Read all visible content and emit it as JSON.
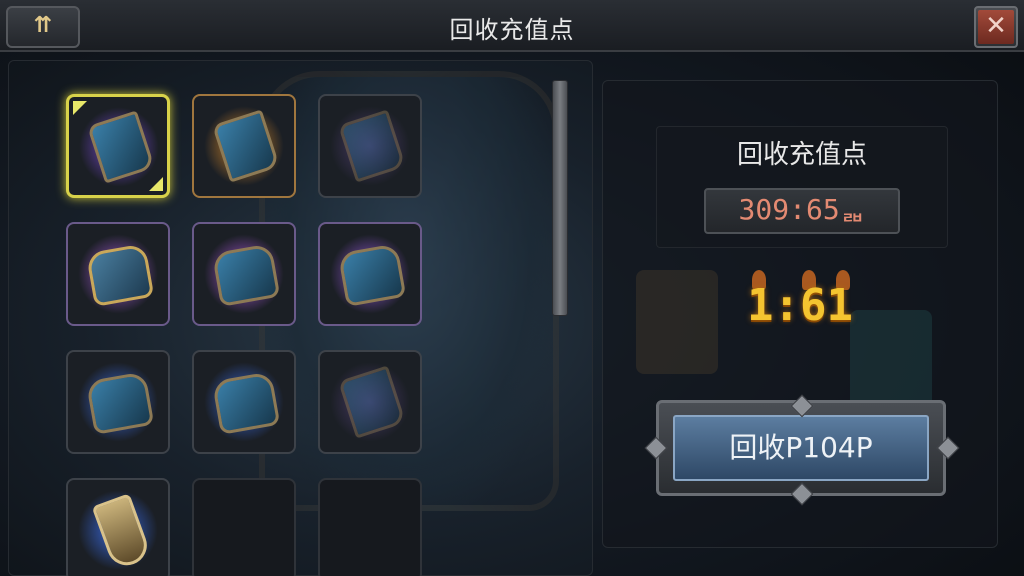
{
  "window": {
    "title": "回收充值点",
    "up_icon_label": "⇈",
    "close_icon_label": "✕"
  },
  "inventory": {
    "slots": [
      {
        "row": 1,
        "col": 1,
        "item": "blue-armor-piece",
        "state": "selected",
        "glow": "#7a4ad8"
      },
      {
        "row": 1,
        "col": 2,
        "item": "blue-armor-piece",
        "state": "normal",
        "glow": "#d98a2a"
      },
      {
        "row": 1,
        "col": 3,
        "item": "blue-armor-piece",
        "state": "dim",
        "glow": "#4a3a6a"
      },
      {
        "row": 2,
        "col": 1,
        "item": "gold-chest-armor",
        "state": "normal",
        "glow": "#a65ad8"
      },
      {
        "row": 2,
        "col": 2,
        "item": "blue-chest-armor",
        "state": "normal",
        "glow": "#b05ae0"
      },
      {
        "row": 2,
        "col": 3,
        "item": "blue-chest-armor",
        "state": "normal",
        "glow": "#9a5ae0"
      },
      {
        "row": 3,
        "col": 1,
        "item": "blue-chest-armor",
        "state": "normal",
        "glow": "#3a6ae0"
      },
      {
        "row": 3,
        "col": 2,
        "item": "blue-chest-armor",
        "state": "normal",
        "glow": "#3a6ae0"
      },
      {
        "row": 3,
        "col": 3,
        "item": "blue-armor-piece",
        "state": "dim",
        "glow": "#4a3a6a"
      },
      {
        "row": 4,
        "col": 1,
        "item": "gold-bell-weapon",
        "state": "normal",
        "glow": "#3a6ae0"
      },
      {
        "row": 4,
        "col": 2,
        "item": "",
        "state": "empty",
        "glow": ""
      },
      {
        "row": 4,
        "col": 3,
        "item": "",
        "state": "empty",
        "glow": ""
      }
    ]
  },
  "panel": {
    "label": "回收充值点",
    "points_value": "309:65ᆲ",
    "ratio": "1:61",
    "recycle_button_label": "回收P104P"
  },
  "colors": {
    "accent_gold": "#f4c430",
    "points_text": "#e38a72",
    "button_blue": "#5c7da0",
    "selected_border": "#d8d24a"
  }
}
